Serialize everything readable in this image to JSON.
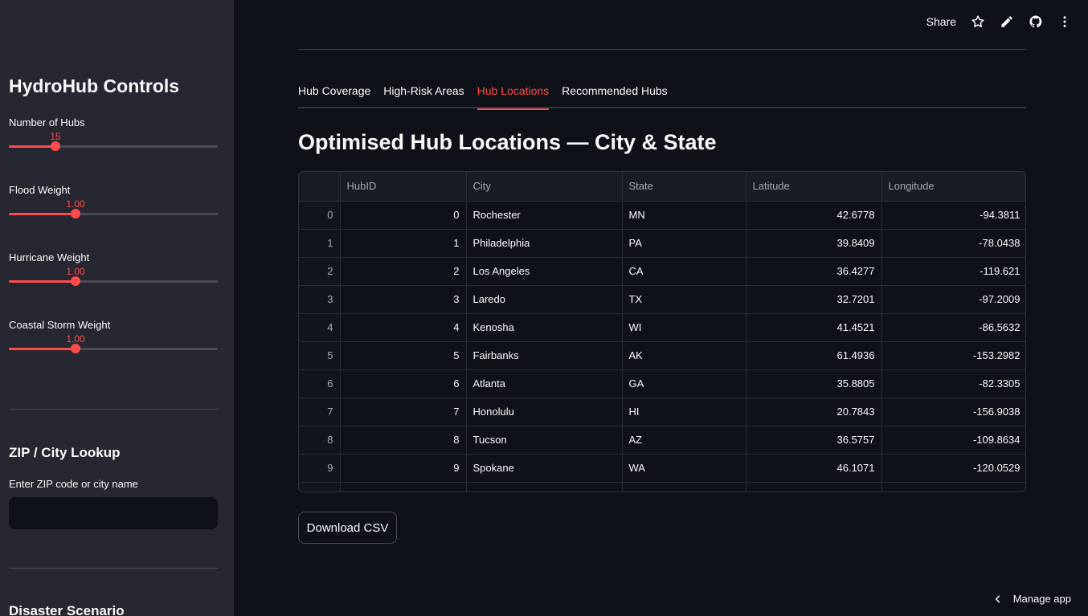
{
  "sidebar": {
    "title": "HydroHub Controls",
    "sliders": [
      {
        "label": "Number of Hubs",
        "value": "15",
        "fraction": 0.22
      },
      {
        "label": "Flood Weight",
        "value": "1.00",
        "fraction": 0.32
      },
      {
        "label": "Hurricane Weight",
        "value": "1.00",
        "fraction": 0.32
      },
      {
        "label": "Coastal Storm Weight",
        "value": "1.00",
        "fraction": 0.32
      }
    ],
    "lookup_heading": "ZIP / City Lookup",
    "lookup_label": "Enter ZIP code or city name",
    "lookup_value": "",
    "scenario_heading": "Disaster Scenario"
  },
  "header": {
    "share": "Share",
    "icons": [
      "star-icon",
      "pencil-icon",
      "github-icon",
      "more-vert-icon"
    ]
  },
  "tabs": [
    {
      "label": "Hub Coverage",
      "active": false
    },
    {
      "label": "High-Risk Areas",
      "active": false
    },
    {
      "label": "Hub Locations",
      "active": true
    },
    {
      "label": "Recommended Hubs",
      "active": false
    }
  ],
  "main": {
    "title": "Optimised Hub Locations — City & State",
    "download_label": "Download CSV"
  },
  "table": {
    "columns": [
      "",
      "HubID",
      "City",
      "State",
      "Latitude",
      "Longitude"
    ],
    "rows": [
      [
        "0",
        "0",
        "Rochester",
        "MN",
        "42.6778",
        "-94.3811"
      ],
      [
        "1",
        "1",
        "Philadelphia",
        "PA",
        "39.8409",
        "-78.0438"
      ],
      [
        "2",
        "2",
        "Los Angeles",
        "CA",
        "36.4277",
        "-119.621"
      ],
      [
        "3",
        "3",
        "Laredo",
        "TX",
        "32.7201",
        "-97.2009"
      ],
      [
        "4",
        "4",
        "Kenosha",
        "WI",
        "41.4521",
        "-86.5632"
      ],
      [
        "5",
        "5",
        "Fairbanks",
        "AK",
        "61.4936",
        "-153.2982"
      ],
      [
        "6",
        "6",
        "Atlanta",
        "GA",
        "35.8805",
        "-82.3305"
      ],
      [
        "7",
        "7",
        "Honolulu",
        "HI",
        "20.7843",
        "-156.9038"
      ],
      [
        "8",
        "8",
        "Tucson",
        "AZ",
        "36.5757",
        "-109.8634"
      ],
      [
        "9",
        "9",
        "Spokane",
        "WA",
        "46.1071",
        "-120.0529"
      ],
      [
        "",
        "",
        "",
        "",
        "",
        ""
      ]
    ]
  },
  "footer": {
    "manage_app": "Manage app"
  },
  "colors": {
    "accent": "#ff4b4b",
    "background": "#0e1117",
    "sidebar": "#262730"
  }
}
